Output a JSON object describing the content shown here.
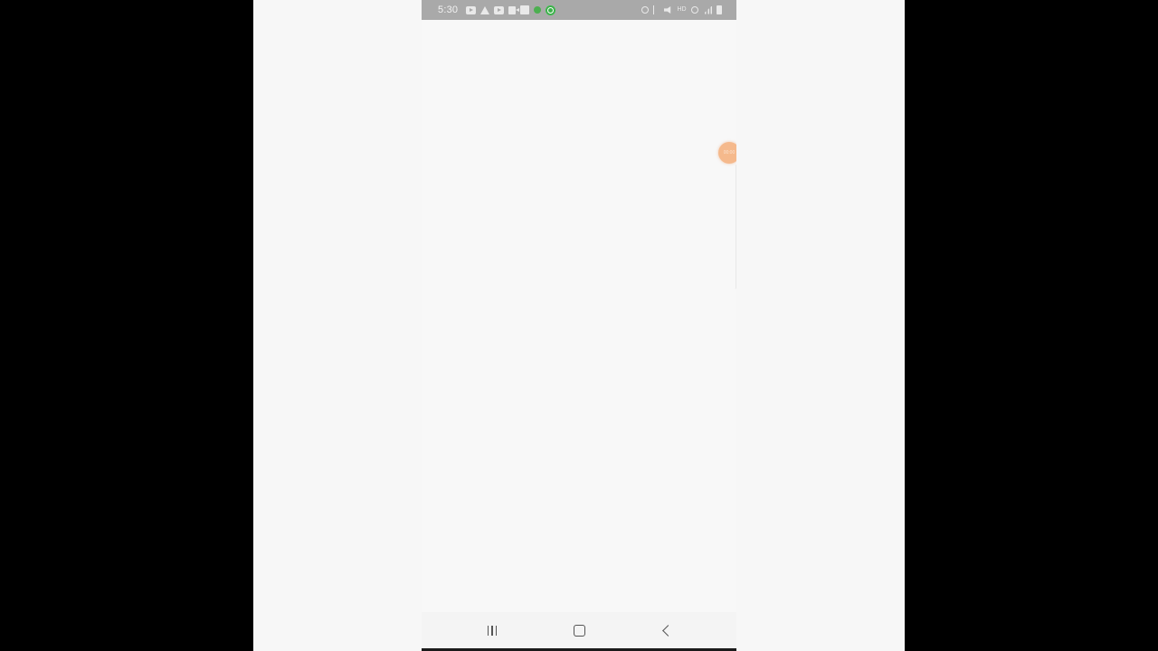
{
  "status_bar": {
    "time": "5:30",
    "left_icons": [
      "youtube-icon",
      "warning-icon",
      "youtube-icon",
      "video-camera-icon",
      "puzzle-icon",
      "green-dot-icon",
      "green-app-icon"
    ],
    "right_icons": [
      "alarm-icon",
      "bluetooth-icon",
      "mute-icon",
      "hd-icon",
      "wifi-icon",
      "signal-icon",
      "battery-icon"
    ],
    "hd_label": "HD",
    "background_color": "#a9a9a9"
  },
  "floating_bubble": {
    "label": "00:00",
    "color": "#f5b98c"
  },
  "nav_bar": {
    "buttons": [
      "recents-button",
      "home-button",
      "back-button"
    ]
  },
  "colors": {
    "outer_background": "#000000",
    "stage_background": "#f7f7f7",
    "screen_background": "#f8f8f8"
  }
}
